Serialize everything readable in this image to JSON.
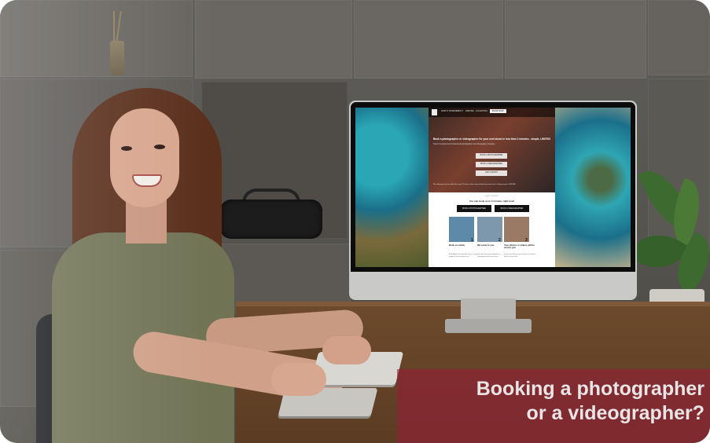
{
  "caption": {
    "line1": "Booking a photographer",
    "line2": "or a videographer?"
  },
  "website": {
    "nav": [
      "HOW IT WORKS",
      "ABOUT",
      "PRICING",
      "LOCATIONS"
    ],
    "nav_cta": "BOOK NOW",
    "hero_title": "Book a photographer or videographer for your next shoot in less than 2 minutes - simple, LIMITED",
    "hero_subtitle": "Team of experienced professional photography and videography company",
    "hero_buttons": [
      "BOOK A PHOTOGRAPHER",
      "BOOK A VIDEOGRAPHER",
      "GIFT A SHOOT"
    ],
    "hero_note": "We will get you set up within the next 12 hours or the same month time were here to help you get a LIMITED",
    "section_kicker": "HOW IT WORKS",
    "section_title": "You can book us in 2 minutes right now!",
    "buttons": [
      "BOOK A PHOTOGRAPHER",
      "BOOK A VIDEOGRAPHER"
    ],
    "steps": [
      {
        "num": "1",
        "title": "Book us online",
        "desc": "Book Adelle Photographer and let us get a proposal and arrange the set"
      },
      {
        "num": "2",
        "title": "We come to you",
        "desc": "Our experienced photographer or videographer will come to you"
      },
      {
        "num": "3",
        "title": "Your photos or videos will be sent to you",
        "desc": "In less than 48 hours your photos and videos will be in your inbox"
      }
    ]
  }
}
